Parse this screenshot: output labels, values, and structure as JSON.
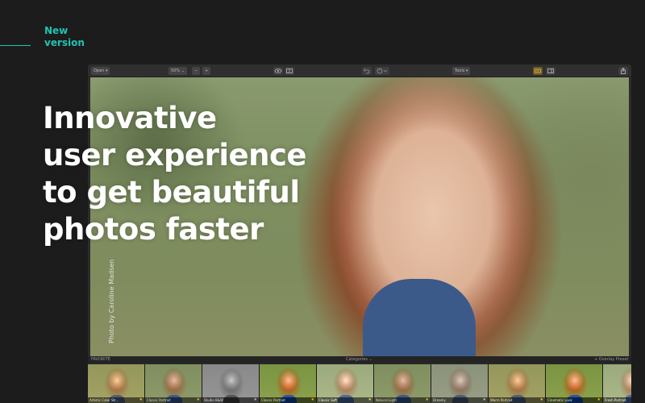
{
  "badge": {
    "line1": "New",
    "line2": "version",
    "accent": "#1fc4b4"
  },
  "headline": {
    "line1": "Innovative",
    "line2": "user experience",
    "line3": "to get beautiful",
    "line4": "photos faster"
  },
  "toolbar": {
    "open_label": "Open ▾",
    "zoom_value": "50% ⌄",
    "zoom_out": "−",
    "zoom_in": "+",
    "tools_label": "Tools ▾",
    "icons": [
      "preview-eye-icon",
      "compare-icon",
      "undo-icon",
      "history-icon",
      "filmstrip-icon",
      "panel-icon",
      "share-icon"
    ]
  },
  "photo": {
    "credit": "Photo by Caroline Madsen"
  },
  "strip": {
    "left_label": "FAVORITE",
    "center_label": "Categories ⌄",
    "right_label": "+ Overlay Preset"
  },
  "thumbnails": [
    {
      "label": "Artistic Color Str...",
      "tone": "warm"
    },
    {
      "label": "Classic Portrait",
      "tone": ""
    },
    {
      "label": "Studio B&W",
      "tone": "bw"
    },
    {
      "label": "Classic Portrait",
      "tone": "vivid"
    },
    {
      "label": "Classic Soft",
      "tone": "bright"
    },
    {
      "label": "Natural Light",
      "tone": ""
    },
    {
      "label": "Dreamy",
      "tone": "cool"
    },
    {
      "label": "Warm Portrait",
      "tone": "warm"
    },
    {
      "label": "Cinematic Look",
      "tone": "vivid"
    },
    {
      "label": "Fresh Portrait",
      "tone": "bright"
    }
  ]
}
